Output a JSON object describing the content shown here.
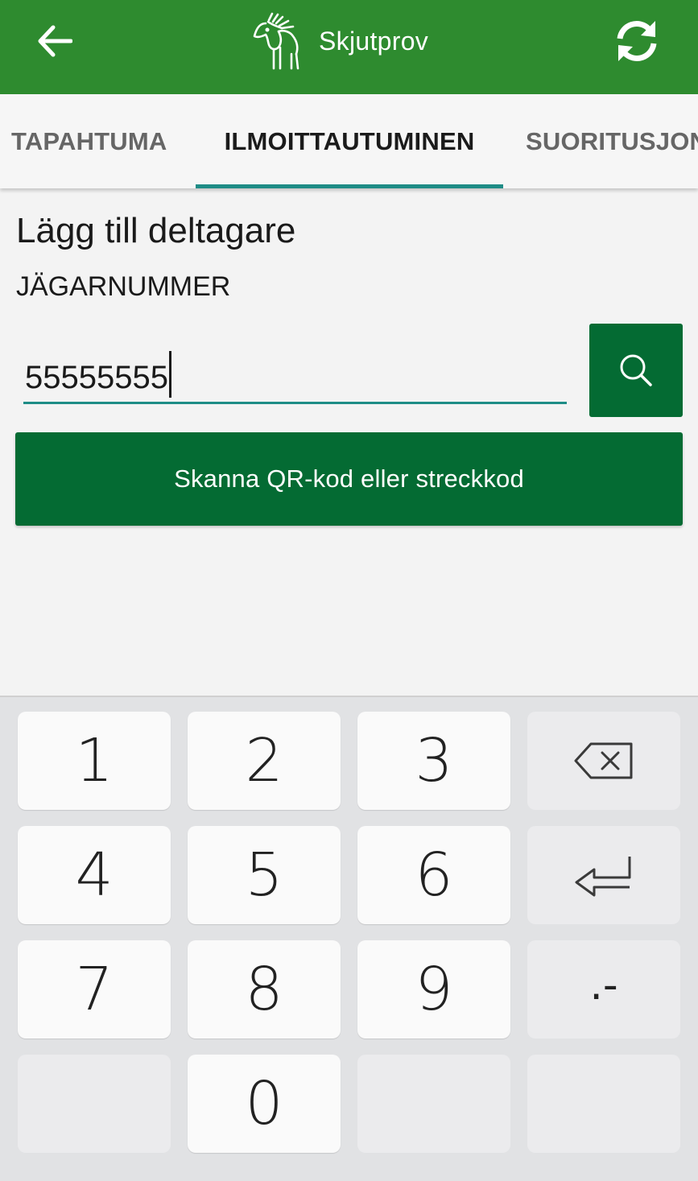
{
  "appbar": {
    "title": "Skjutprov",
    "back_icon": "arrow-left-icon",
    "refresh_icon": "refresh-icon",
    "logo": "moose-logo",
    "color": "#2e8b2f"
  },
  "tabs": [
    {
      "label": "TAPAHTUMA",
      "selected": false
    },
    {
      "label": "ILMOITTAUTUMINEN",
      "selected": true
    },
    {
      "label": "SUORITUSJONO",
      "selected": false
    }
  ],
  "form": {
    "heading": "Lägg till deltagare",
    "field_label": "JÄGARNUMMER",
    "input_value": "55555555",
    "search_icon": "search-icon",
    "scan_button_label": "Skanna QR-kod eller streckkod",
    "accent": "#046b33"
  },
  "keyboard": {
    "keys": [
      "1",
      "2",
      "3",
      "4",
      "5",
      "6",
      "7",
      "8",
      "9",
      "0"
    ],
    "punct_key": ".-",
    "backspace_icon": "backspace-icon",
    "enter_icon": "enter-icon"
  }
}
